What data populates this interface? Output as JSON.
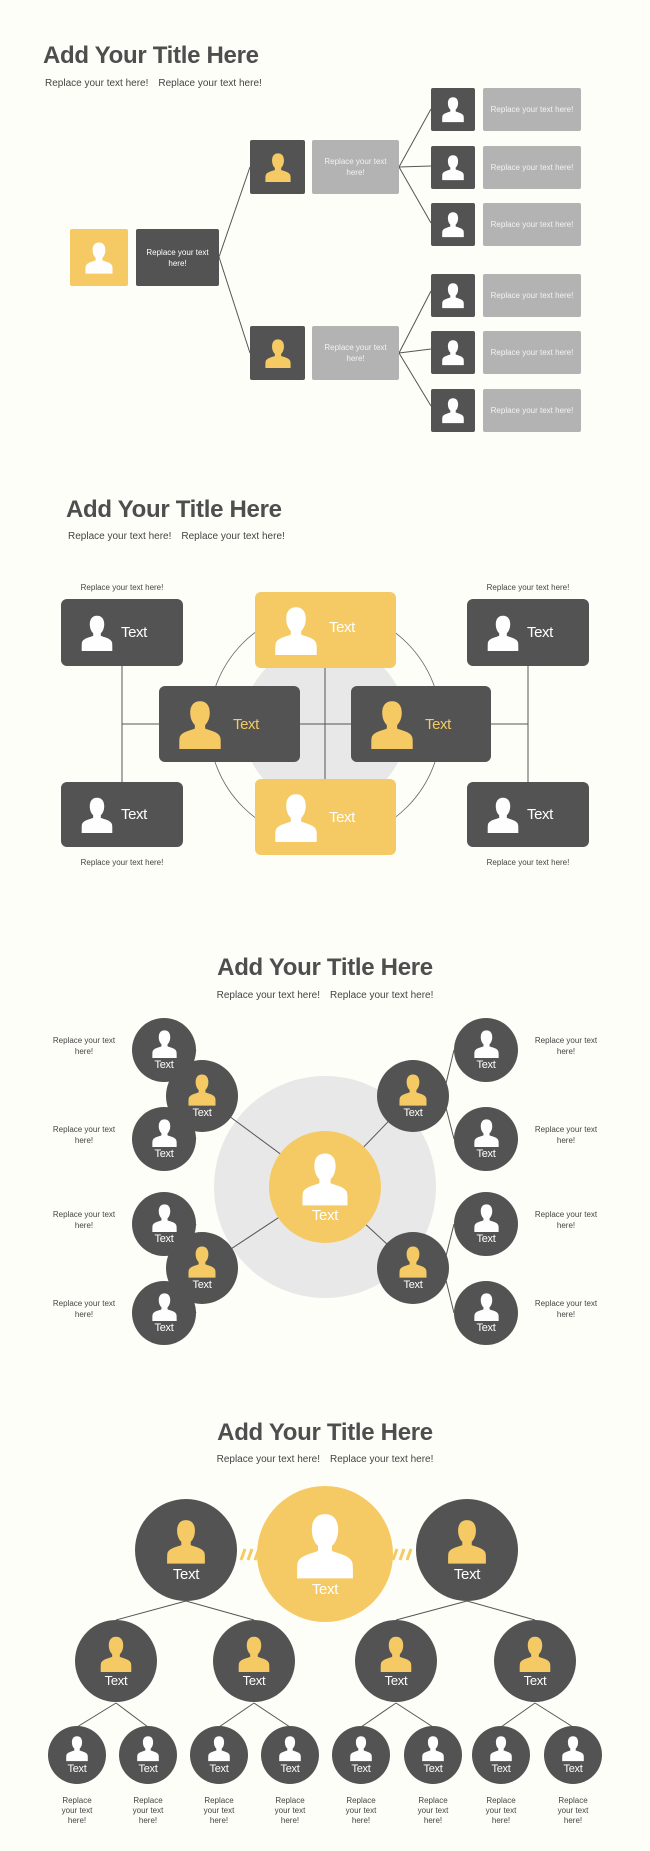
{
  "colors": {
    "dark": "#535353",
    "yellow": "#f5ca65",
    "gray": "#b3b3b3",
    "background": "#fefef8",
    "line": "#555555",
    "halo": "#e8e8e8"
  },
  "section1": {
    "title": "Add Your Title Here",
    "subtitle": [
      "Replace your text here!",
      "Replace your text here!"
    ],
    "root": {
      "icon": "person-icon",
      "text": "Replace your text here!"
    },
    "branches": [
      {
        "text": "Replace your text here!",
        "leaves": [
          "Replace your text here!",
          "Replace your text here!",
          "Replace your text here!"
        ]
      },
      {
        "text": "Replace your text here!",
        "leaves": [
          "Replace your text here!",
          "Replace your text here!",
          "Replace your text here!"
        ]
      }
    ]
  },
  "section2": {
    "title": "Add Your Title Here",
    "subtitle": [
      "Replace your text here!",
      "Replace your text here!"
    ],
    "center_cards": {
      "top": "Text",
      "left": "Text",
      "right": "Text",
      "bottom": "Text"
    },
    "corner_cards": {
      "top_left": "Text",
      "top_right": "Text",
      "bottom_left": "Text",
      "bottom_right": "Text"
    },
    "corner_notes": {
      "top_left": "Replace your text here!",
      "top_right": "Replace your text here!",
      "bottom_left": "Replace your text here!",
      "bottom_right": "Replace your text here!"
    }
  },
  "section3": {
    "title": "Add Your Title Here",
    "subtitle": [
      "Replace your text here!",
      "Replace your text here!"
    ],
    "center": "Text",
    "mid": [
      "Text",
      "Text",
      "Text",
      "Text"
    ],
    "outer_left": [
      {
        "label": "Text",
        "note": "Replace your text here!"
      },
      {
        "label": "Text",
        "note": "Replace your text here!"
      },
      {
        "label": "Text",
        "note": "Replace your text here!"
      },
      {
        "label": "Text",
        "note": "Replace your text here!"
      }
    ],
    "outer_right": [
      {
        "label": "Text",
        "note": "Replace your text here!"
      },
      {
        "label": "Text",
        "note": "Replace your text here!"
      },
      {
        "label": "Text",
        "note": "Replace your text here!"
      },
      {
        "label": "Text",
        "note": "Replace your text here!"
      }
    ]
  },
  "section4": {
    "title": "Add Your Title Here",
    "subtitle": [
      "Replace your text here!",
      "Replace your text here!"
    ],
    "center": "Text",
    "top_left": "Text",
    "top_right": "Text",
    "mid": [
      "Text",
      "Text",
      "Text",
      "Text"
    ],
    "leaves": [
      {
        "label": "Text",
        "note": "Replace your text here!"
      },
      {
        "label": "Text",
        "note": "Replace your text here!"
      },
      {
        "label": "Text",
        "note": "Replace your text here!"
      },
      {
        "label": "Text",
        "note": "Replace your text here!"
      },
      {
        "label": "Text",
        "note": "Replace your text here!"
      },
      {
        "label": "Text",
        "note": "Replace your text here!"
      },
      {
        "label": "Text",
        "note": "Replace your text here!"
      },
      {
        "label": "Text",
        "note": "Replace your text here!"
      }
    ]
  }
}
